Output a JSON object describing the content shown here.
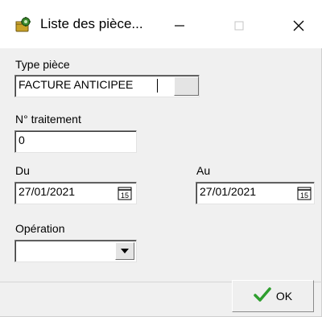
{
  "window": {
    "title": "Liste des pièce...",
    "title_icon": "gear-folder-icon",
    "controls": {
      "minimize": "minimize-icon",
      "maximize": "maximize-icon",
      "close": "close-icon"
    }
  },
  "form": {
    "type_piece": {
      "label": "Type pièce",
      "value": "FACTURE ANTICIPEE"
    },
    "num_traitement": {
      "label": "N° traitement",
      "value": "0"
    },
    "du": {
      "label": "Du",
      "value": "27/01/2021",
      "calendar_icon": "calendar-icon"
    },
    "au": {
      "label": "Au",
      "value": "27/01/2021",
      "calendar_icon": "calendar-icon"
    },
    "operation": {
      "label": "Opération",
      "value": ""
    }
  },
  "footer": {
    "ok_label": "OK",
    "ok_icon": "checkmark-icon",
    "colors": {
      "check": "#2e9e2e"
    }
  }
}
